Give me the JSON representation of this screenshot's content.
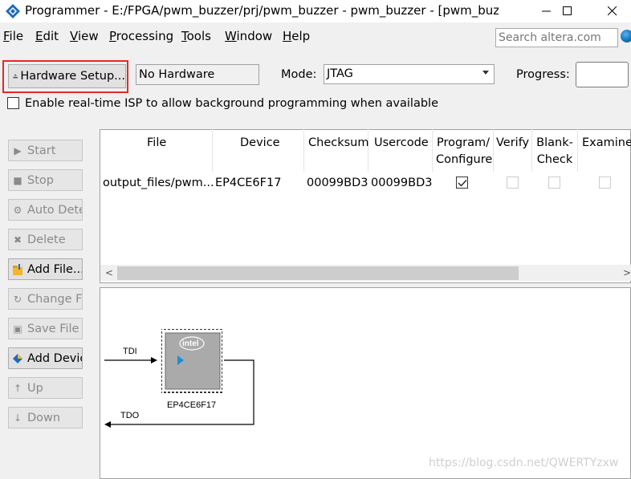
{
  "window": {
    "title": "Programmer - E:/FPGA/pwm_buzzer/prj/pwm_buzzer - pwm_buzzer - [pwm_buz...",
    "controls": [
      "minimize",
      "maximize",
      "close"
    ]
  },
  "menu": {
    "items": [
      {
        "key": "F",
        "rest": "ile"
      },
      {
        "key": "E",
        "rest": "dit"
      },
      {
        "key": "V",
        "rest": "iew"
      },
      {
        "key": "P",
        "rest": "rocessing"
      },
      {
        "key": "T",
        "rest": "ools"
      },
      {
        "key": "W",
        "rest": "indow"
      },
      {
        "key": "H",
        "rest": "elp"
      }
    ],
    "search_placeholder": "Search altera.com"
  },
  "toolbar": {
    "hardware_setup": "Hardware Setup...",
    "hardware_value": "No Hardware",
    "mode_label": "Mode:",
    "mode_value": "JTAG",
    "progress_label": "Progress:",
    "progress_value": "",
    "isp_label": "Enable real-time ISP to allow background programming when available",
    "isp_checked": false
  },
  "sidebar": {
    "buttons": [
      {
        "label": "Start",
        "enabled": false
      },
      {
        "label": "Stop",
        "enabled": false
      },
      {
        "label": "Auto Detec",
        "enabled": false
      },
      {
        "label": "Delete",
        "enabled": false
      },
      {
        "label": "Add File...",
        "enabled": true
      },
      {
        "label": "Change File",
        "enabled": false
      },
      {
        "label": "Save File",
        "enabled": false
      },
      {
        "label": "Add Device",
        "enabled": true
      },
      {
        "label": "Up",
        "enabled": false
      },
      {
        "label": "Down",
        "enabled": false
      }
    ]
  },
  "table": {
    "headers": {
      "file": "File",
      "device": "Device",
      "checksum": "Checksum",
      "usercode": "Usercode",
      "program_1": "Program/",
      "program_2": "Configure",
      "verify": "Verify",
      "blank_1": "Blank-",
      "blank_2": "Check",
      "examine": "Examine"
    },
    "row": {
      "file": "output_files/pwm...",
      "device": "EP4CE6F17",
      "checksum": "00099BD3",
      "usercode": "00099BD3",
      "program": true,
      "verify": false,
      "blank_check": false,
      "examine": false
    }
  },
  "diagram": {
    "tdi_label": "TDI",
    "tdo_label": "TDO",
    "chip_label": "EP4CE6F17",
    "logo_text": "intel"
  },
  "watermark": "https://blog.csdn.net/QWERTYzxw"
}
